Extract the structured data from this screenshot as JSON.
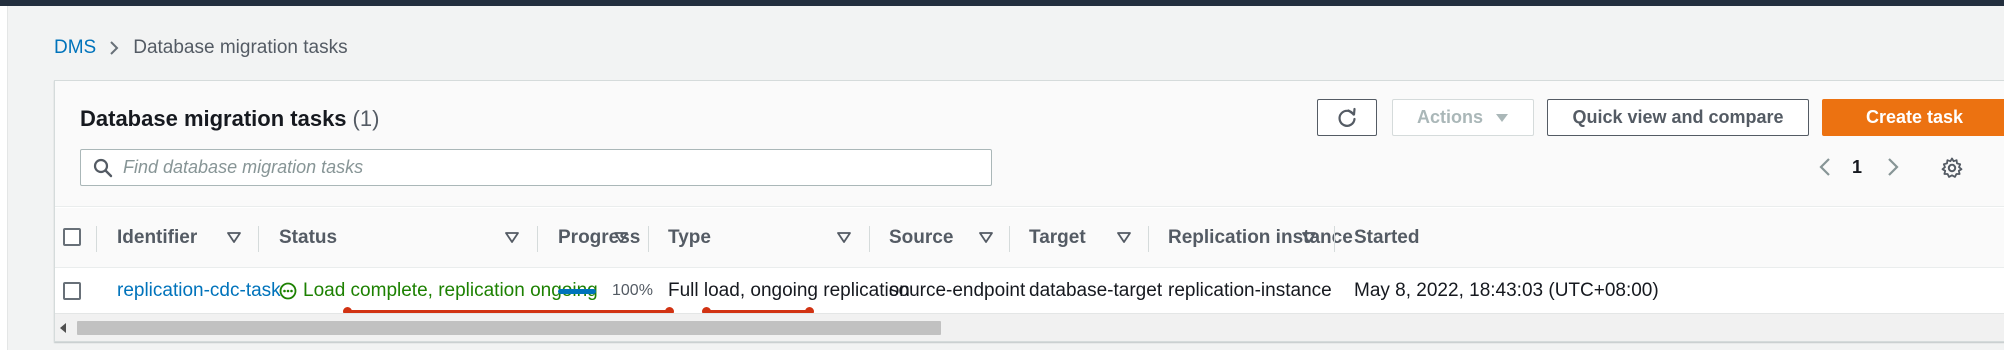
{
  "breadcrumb": {
    "root": "DMS",
    "current": "Database migration tasks"
  },
  "panel": {
    "title": "Database migration tasks",
    "count": "(1)",
    "search_placeholder": "Find database migration tasks"
  },
  "buttons": {
    "refresh_icon": "refresh-icon",
    "actions": "Actions",
    "quick_view": "Quick view and compare",
    "create_task": "Create task"
  },
  "pagination": {
    "current_page": "1"
  },
  "table": {
    "columns": [
      "Identifier",
      "Status",
      "Progress",
      "Type",
      "Source",
      "Target",
      "Replication instance",
      "Started"
    ],
    "rows": [
      {
        "identifier": "replication-cdc-task",
        "status": "Load complete, replication ongoing",
        "progress": "100%",
        "progress_value": 1.0,
        "type": "Full load, ongoing replication",
        "source": "source-endpoint",
        "target": "database-target",
        "replication_instance": "replication-instance",
        "started": "May 8, 2022, 18:43:03 (UTC+08:00)"
      }
    ]
  },
  "colors": {
    "link": "#0073bb",
    "primary_button": "#ec7211",
    "status_success": "#1d8102",
    "annotation": "#d13212"
  }
}
